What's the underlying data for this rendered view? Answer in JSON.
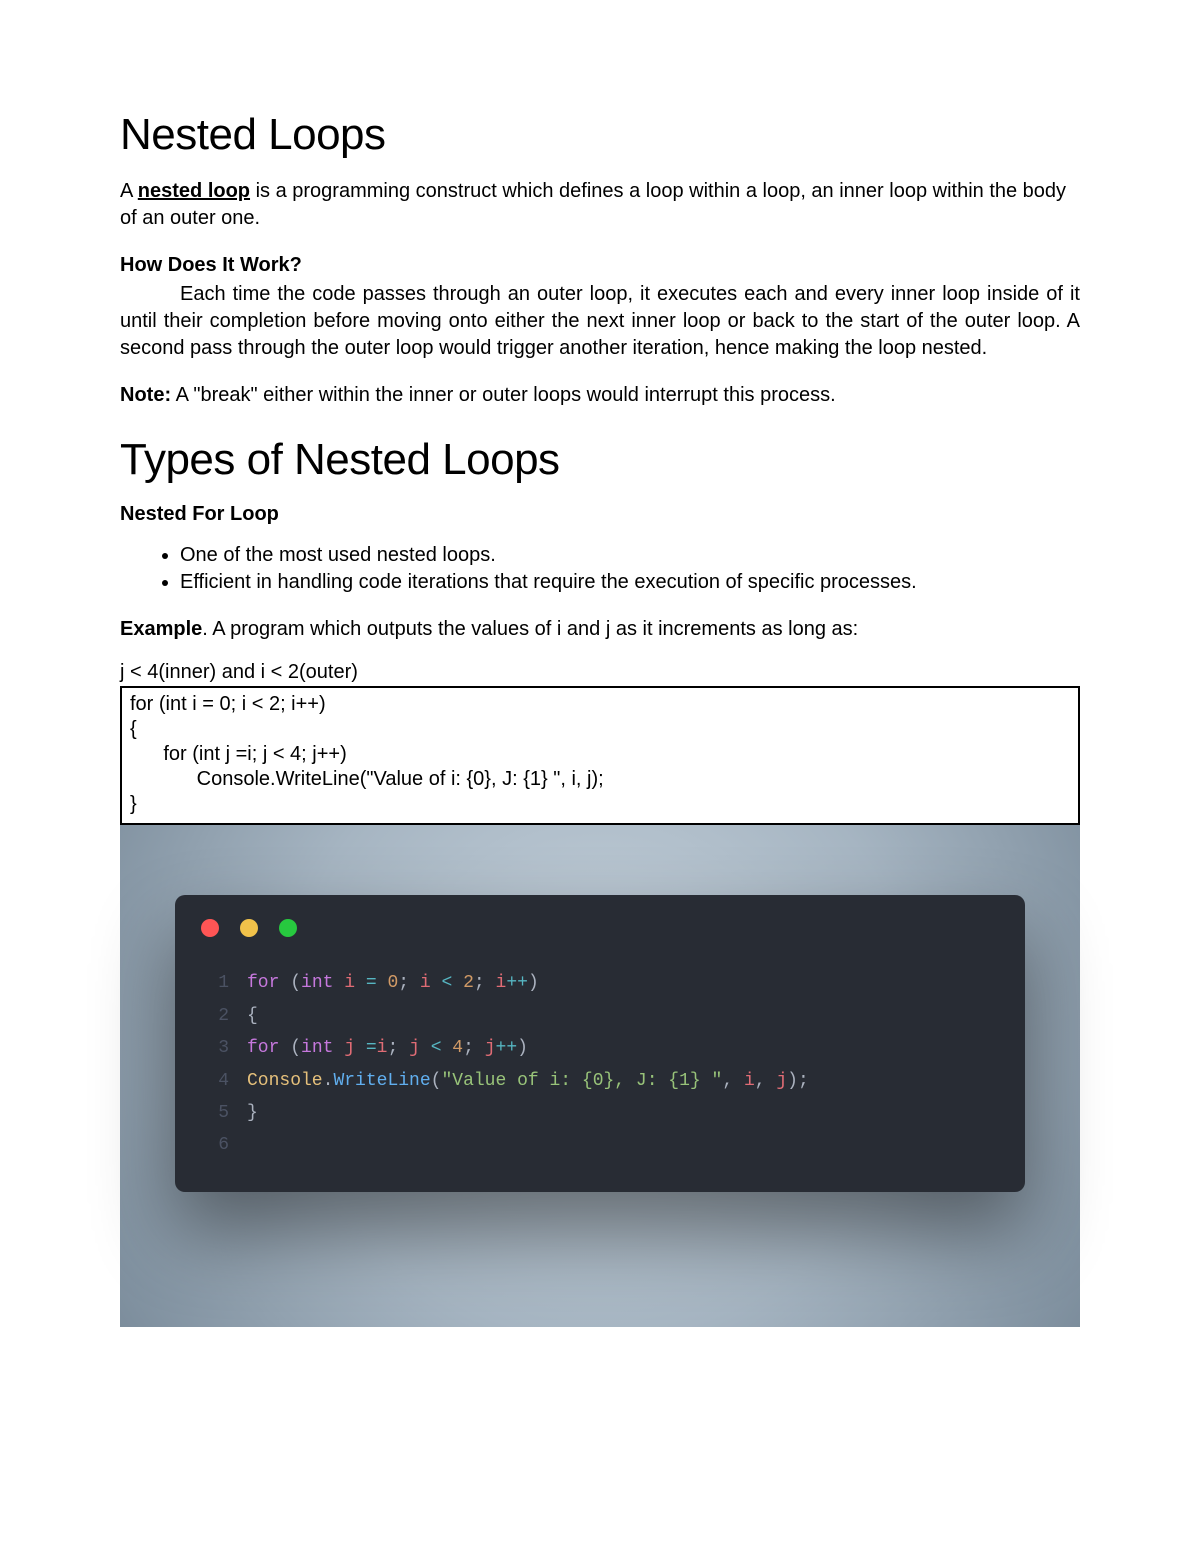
{
  "heading1": "Nested Loops",
  "intro_pre": "A ",
  "intro_term": "nested loop",
  "intro_post": " is a programming construct which defines a loop within a loop, an inner loop within the body of an outer one.",
  "how_title": "How Does It Work?",
  "how_body": "Each time the code passes through an outer loop, it executes each and every inner loop inside of it until their completion before moving onto either the next inner loop or back to the start of the outer loop. A second pass through the outer loop would trigger another iteration, hence making the loop nested.",
  "note_label": "Note:",
  "note_text": " A \"break\" either within the inner or outer loops would interrupt this process.",
  "heading2": "Types of Nested Loops",
  "sub2": "Nested For Loop",
  "bullets": {
    "0": "One of the most used nested loops.",
    "1": "Efficient in handling code iterations that require the execution of specific processes."
  },
  "example_label": "Example",
  "example_text1": ". A program which outputs the values of i and j as it increments as long as:",
  "example_text2": "j < 4(inner) and i < 2(outer)",
  "codebox": "for (int i = 0; i < 2; i++)\n{\n      for (int j =i; j < 4; j++)\n            Console.WriteLine(\"Value of i: {0}, J: {1} \", i, j);\n}",
  "term": {
    "ln": {
      "1": "1",
      "2": "2",
      "3": "3",
      "4": "4",
      "5": "5",
      "6": "6"
    },
    "l1": {
      "for": "for",
      "open": " (",
      "int": "int",
      "sp": " ",
      "i": "i",
      "eq": " = ",
      "z": "0",
      "sc1": "; ",
      "i2": "i",
      "lt": " < ",
      "two": "2",
      "sc2": "; ",
      "i3": "i",
      "pp": "++",
      "close": ")"
    },
    "l2": "{",
    "l3": {
      "pad": "  ",
      "for": "for",
      "open": " (",
      "int": "int",
      "sp": " ",
      "j": "j",
      "eq": " =",
      "i": "i",
      "sc1": "; ",
      "j2": "j",
      "lt": " < ",
      "four": "4",
      "sc2": "; ",
      "j3": "j",
      "pp": "++",
      "close": ")"
    },
    "l4": {
      "pad": "  ",
      "console": "Console",
      "dot": ".",
      "fn": "WriteLine",
      "open": "(",
      "str": "\"Value of i: {0}, J: {1} \"",
      "c1": ", ",
      "i": "i",
      "c2": ", ",
      "j": "j",
      "close": ");"
    },
    "l5": "  }"
  }
}
